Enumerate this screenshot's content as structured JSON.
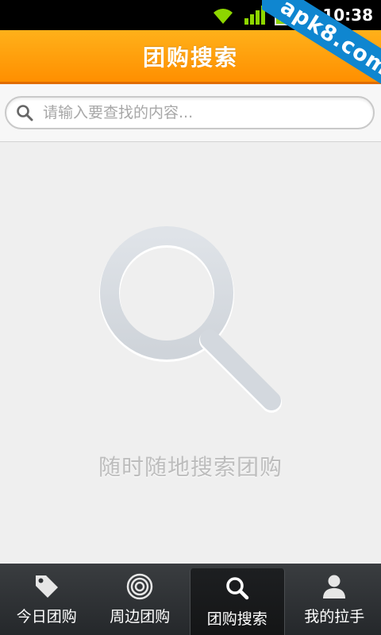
{
  "status_bar": {
    "time": "10:38",
    "watermark": "apk8.com"
  },
  "header": {
    "title": "团购搜索"
  },
  "search": {
    "placeholder": "请输入要查找的内容..."
  },
  "empty_state": {
    "message": "随时随地搜索团购"
  },
  "tabs": [
    {
      "label": "今日团购",
      "icon": "tag-icon"
    },
    {
      "label": "周边团购",
      "icon": "radar-icon"
    },
    {
      "label": "团购搜索",
      "icon": "search-icon",
      "active": true
    },
    {
      "label": "我的拉手",
      "icon": "user-icon"
    }
  ],
  "colors": {
    "accent": "#ff9e0d",
    "tabbar": "#2e3134",
    "watermark": "#0f86d0"
  }
}
